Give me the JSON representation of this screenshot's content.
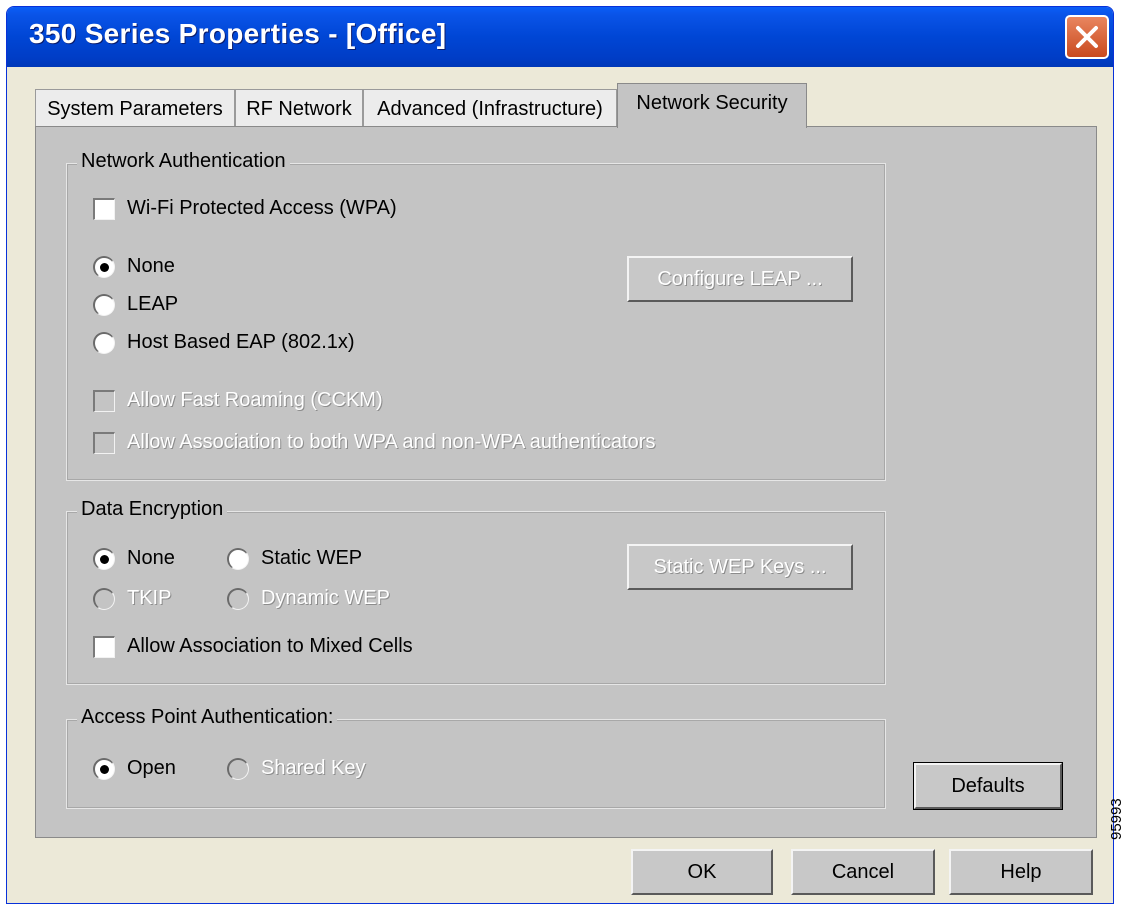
{
  "window": {
    "title": "350 Series Properties - [Office]",
    "close_icon": "close-icon"
  },
  "tabs": [
    {
      "label": "System Parameters",
      "active": false
    },
    {
      "label": "RF Network",
      "active": false
    },
    {
      "label": "Advanced (Infrastructure)",
      "active": false
    },
    {
      "label": "Network Security",
      "active": true
    }
  ],
  "network_authentication": {
    "label": "Network Authentication",
    "wpa": {
      "label": "Wi-Fi Protected Access (WPA)",
      "checked": false
    },
    "options": [
      {
        "label": "None",
        "selected": true
      },
      {
        "label": "LEAP",
        "selected": false
      },
      {
        "label": "Host Based EAP (802.1x)",
        "selected": false
      }
    ],
    "configure_leap_label": "Configure LEAP ...",
    "fast_roaming": {
      "label": "Allow Fast Roaming (CCKM)",
      "enabled": false
    },
    "mixed_wpa": {
      "label": "Allow Association to both WPA and non-WPA authenticators",
      "enabled": false
    }
  },
  "data_encryption": {
    "label": "Data Encryption",
    "options": [
      {
        "label": "None",
        "selected": true,
        "enabled": true
      },
      {
        "label": "Static WEP",
        "selected": false,
        "enabled": true
      },
      {
        "label": "TKIP",
        "selected": false,
        "enabled": false
      },
      {
        "label": "Dynamic WEP",
        "selected": false,
        "enabled": false
      }
    ],
    "static_wep_keys_label": "Static WEP Keys ...",
    "mixed_cells": {
      "label": "Allow Association to Mixed Cells",
      "checked": false
    }
  },
  "access_point_authentication": {
    "label": "Access Point Authentication:",
    "options": [
      {
        "label": "Open",
        "selected": true,
        "enabled": true
      },
      {
        "label": "Shared Key",
        "selected": false,
        "enabled": false
      }
    ]
  },
  "buttons": {
    "defaults": "Defaults",
    "ok": "OK",
    "cancel": "Cancel",
    "help": "Help"
  },
  "figure_number": "95993"
}
